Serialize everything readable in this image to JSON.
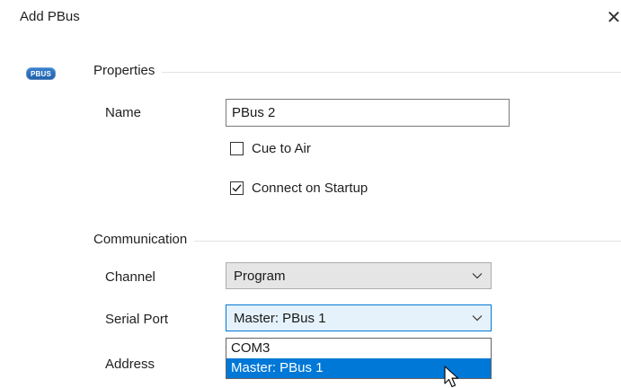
{
  "dialog": {
    "title": "Add PBus",
    "close_glyph": "✕",
    "badge_text": "PBUS",
    "badge_icon": "pbus-icon",
    "accent_color": "#0078d7"
  },
  "properties": {
    "section_label": "Properties",
    "name_label": "Name",
    "name_value": "PBus 2",
    "cue_to_air_label": "Cue to Air",
    "cue_to_air_checked": false,
    "connect_on_startup_label": "Connect on Startup",
    "connect_on_startup_checked": true
  },
  "communication": {
    "section_label": "Communication",
    "channel_label": "Channel",
    "channel_value": "Program",
    "serial_port_label": "Serial Port",
    "serial_port_value": "Master: PBus 1",
    "serial_port_options": [
      "COM3",
      "Master: PBus 1"
    ],
    "serial_port_highlighted": "Master: PBus 1",
    "address_label": "Address"
  }
}
